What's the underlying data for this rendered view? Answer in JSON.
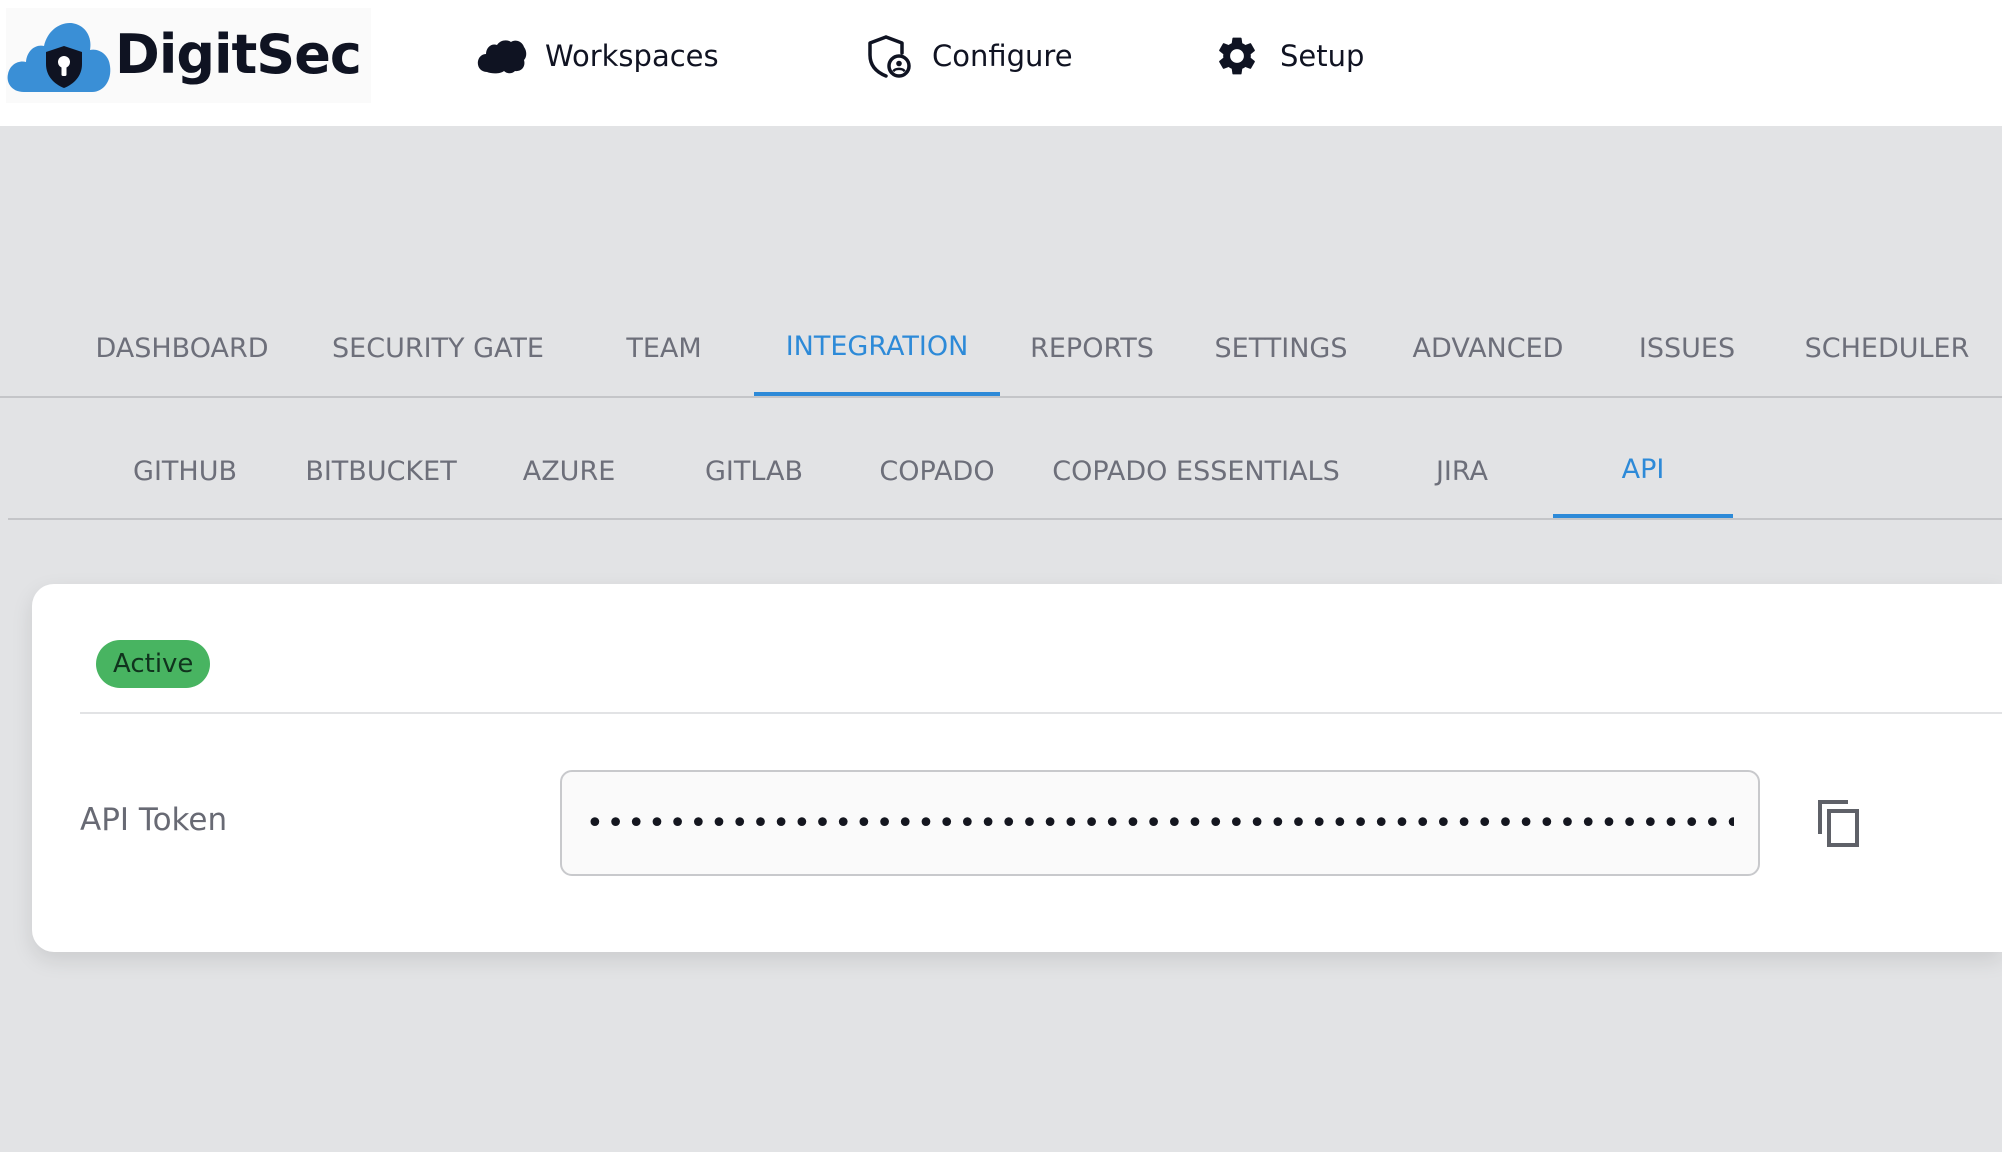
{
  "header": {
    "logo_text": "DigitSec",
    "nav": [
      {
        "label": "Workspaces",
        "icon": "salesforce-cloud-icon"
      },
      {
        "label": "Configure",
        "icon": "shield-user-icon"
      },
      {
        "label": "Setup",
        "icon": "gear-icon"
      }
    ]
  },
  "tabs": [
    {
      "label": "DASHBOARD",
      "active": false
    },
    {
      "label": "SECURITY GATE",
      "active": false
    },
    {
      "label": "TEAM",
      "active": false
    },
    {
      "label": "INTEGRATION",
      "active": true
    },
    {
      "label": "REPORTS",
      "active": false
    },
    {
      "label": "SETTINGS",
      "active": false
    },
    {
      "label": "ADVANCED",
      "active": false
    },
    {
      "label": "ISSUES",
      "active": false
    },
    {
      "label": "SCHEDULER",
      "active": false
    }
  ],
  "subtabs": [
    {
      "label": "GITHUB",
      "active": false
    },
    {
      "label": "BITBUCKET",
      "active": false
    },
    {
      "label": "AZURE",
      "active": false
    },
    {
      "label": "GITLAB",
      "active": false
    },
    {
      "label": "COPADO",
      "active": false
    },
    {
      "label": "COPADO ESSENTIALS",
      "active": false
    },
    {
      "label": "JIRA",
      "active": false
    },
    {
      "label": "API",
      "active": true
    }
  ],
  "api_card": {
    "status_badge": "Active",
    "token_label": "API Token",
    "token_value": "••••••••••••••••••••••••••••••••••••••••••••••••••••••••••••••••••••",
    "copy_icon": "copy-icon"
  },
  "colors": {
    "accent": "#2d8ad8",
    "badge_green": "#48b461",
    "page_background": "#e2e3e5",
    "logo_blue": "#3a8fd6",
    "logo_dark": "#0f1322"
  }
}
